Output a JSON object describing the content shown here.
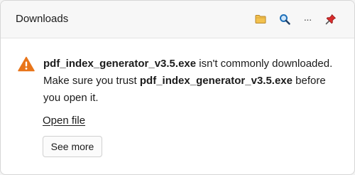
{
  "header": {
    "title": "Downloads",
    "icons": [
      "folder-icon",
      "search-icon",
      "more-icon",
      "pin-icon"
    ],
    "more_glyph": "···"
  },
  "warning": {
    "icon": "warning-triangle-icon",
    "filename": "pdf_index_generator_v3.5.exe",
    "text_part1": " isn't commonly downloaded. Make sure you trust ",
    "text_part2": " before you open it."
  },
  "actions": {
    "open_file": "Open file",
    "see_more": "See more"
  },
  "colors": {
    "folder": "#f2c14e",
    "search": "#1e6fb8",
    "pin": "#d92b2b",
    "warning": "#e8751a"
  }
}
